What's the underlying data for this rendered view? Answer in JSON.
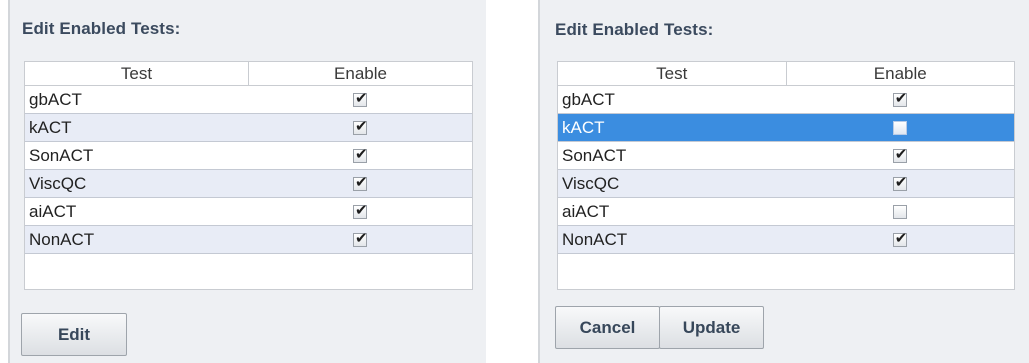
{
  "left_panel": {
    "title": "Edit Enabled Tests:",
    "columns": [
      "Test",
      "Enable"
    ],
    "rows": [
      {
        "name": "gbACT",
        "enabled": true
      },
      {
        "name": "kACT",
        "enabled": true
      },
      {
        "name": "SonACT",
        "enabled": true
      },
      {
        "name": "ViscQC",
        "enabled": true
      },
      {
        "name": "aiACT",
        "enabled": true
      },
      {
        "name": "NonACT",
        "enabled": true
      }
    ],
    "edit_label": "Edit"
  },
  "right_panel": {
    "title": "Edit Enabled Tests:",
    "columns": [
      "Test",
      "Enable"
    ],
    "selected_row": "kACT",
    "rows": [
      {
        "name": "gbACT",
        "enabled": true
      },
      {
        "name": "kACT",
        "enabled": false
      },
      {
        "name": "SonACT",
        "enabled": true
      },
      {
        "name": "ViscQC",
        "enabled": true
      },
      {
        "name": "aiACT",
        "enabled": false
      },
      {
        "name": "NonACT",
        "enabled": true
      }
    ],
    "cancel_label": "Cancel",
    "update_label": "Update"
  },
  "colors": {
    "panel_bg": "#eef0f3",
    "title_text": "#3b4a5e",
    "alt_row_bg": "#e8ecf6",
    "selected_row_bg": "#3b8de0"
  },
  "icons": {
    "checked": "checkmark-icon"
  }
}
